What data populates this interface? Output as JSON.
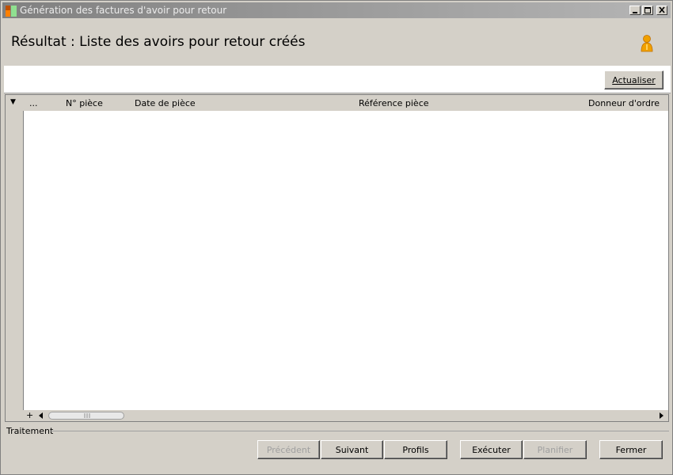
{
  "window": {
    "title": "Génération des factures d'avoir pour retour",
    "controls": [
      "minimize",
      "maximize",
      "close"
    ]
  },
  "header": {
    "title": "Résultat :  Liste des avoirs pour retour créés",
    "user_icon": "user-icon"
  },
  "toolbar": {
    "refresh_label": "Actualiser"
  },
  "grid": {
    "row_selector": "▼",
    "columns": [
      "...",
      "N° pièce",
      "Date de pièce",
      "Référence pièce",
      "Donneur d'ordre"
    ],
    "rows": [],
    "expand_symbol": "+"
  },
  "status": {
    "label": "Traitement"
  },
  "footer": {
    "previous_label": "Précédent",
    "next_label": "Suivant",
    "profiles_label": "Profils",
    "execute_label": "Exécuter",
    "schedule_label": "Planifier",
    "close_label": "Fermer"
  },
  "colors": {
    "window_bg": "#d4d0c8",
    "titlebar_start": "#808080",
    "accent_user": "#f0a000"
  }
}
